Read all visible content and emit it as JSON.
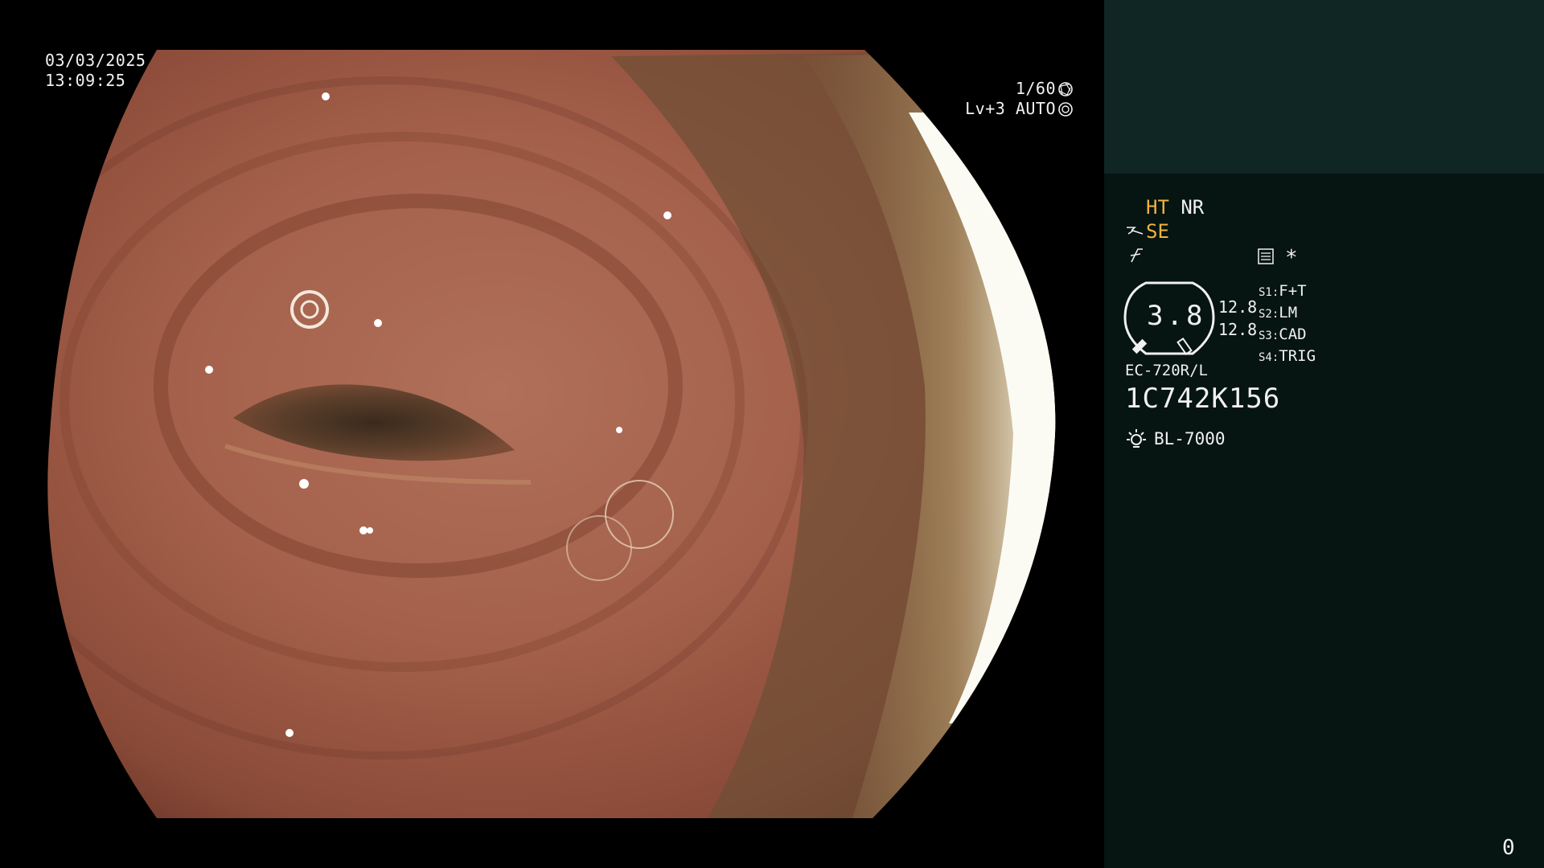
{
  "overlay": {
    "date": "03/03/2025",
    "time": "13:09:25",
    "shutter": "1/60",
    "level": "Lv+3 AUTO"
  },
  "panel": {
    "mode_ht": "HT",
    "mode_nr": "NR",
    "mode_se": "SE",
    "gauge_value": "3.8",
    "value_1": "12.8",
    "value_2": "12.8",
    "slots": [
      {
        "key": "S1:",
        "value": "F+T"
      },
      {
        "key": "S2:",
        "value": "LM"
      },
      {
        "key": "S3:",
        "value": "CAD"
      },
      {
        "key": "S4:",
        "value": "TRIG"
      }
    ],
    "scope_model": "EC-720R/L",
    "scope_serial": "1C742K156",
    "light_source": "BL-7000",
    "counter": "0",
    "star": "*"
  },
  "icons": [
    "shutter-aperture-icon",
    "auto-iris-icon",
    "se-mode-icon",
    "f-mode-icon",
    "menu-list-icon",
    "light-source-icon",
    "scope-gauge-icon"
  ],
  "colors": {
    "accent": "#f0b43c",
    "panel_bg": "#061412",
    "panel_top": "#0f2624"
  }
}
